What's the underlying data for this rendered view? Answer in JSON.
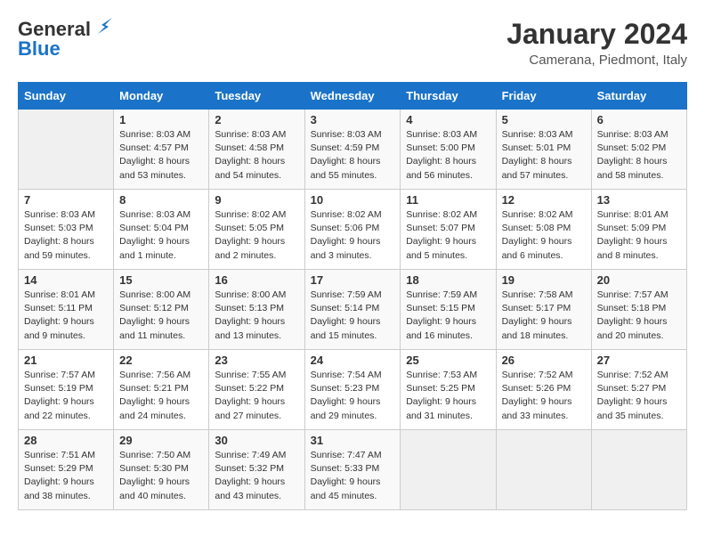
{
  "logo": {
    "line1": "General",
    "line2": "Blue"
  },
  "title": "January 2024",
  "location": "Camerana, Piedmont, Italy",
  "weekdays": [
    "Sunday",
    "Monday",
    "Tuesday",
    "Wednesday",
    "Thursday",
    "Friday",
    "Saturday"
  ],
  "weeks": [
    [
      {
        "day": "",
        "info": ""
      },
      {
        "day": "1",
        "info": "Sunrise: 8:03 AM\nSunset: 4:57 PM\nDaylight: 8 hours\nand 53 minutes."
      },
      {
        "day": "2",
        "info": "Sunrise: 8:03 AM\nSunset: 4:58 PM\nDaylight: 8 hours\nand 54 minutes."
      },
      {
        "day": "3",
        "info": "Sunrise: 8:03 AM\nSunset: 4:59 PM\nDaylight: 8 hours\nand 55 minutes."
      },
      {
        "day": "4",
        "info": "Sunrise: 8:03 AM\nSunset: 5:00 PM\nDaylight: 8 hours\nand 56 minutes."
      },
      {
        "day": "5",
        "info": "Sunrise: 8:03 AM\nSunset: 5:01 PM\nDaylight: 8 hours\nand 57 minutes."
      },
      {
        "day": "6",
        "info": "Sunrise: 8:03 AM\nSunset: 5:02 PM\nDaylight: 8 hours\nand 58 minutes."
      }
    ],
    [
      {
        "day": "7",
        "info": "Sunrise: 8:03 AM\nSunset: 5:03 PM\nDaylight: 8 hours\nand 59 minutes."
      },
      {
        "day": "8",
        "info": "Sunrise: 8:03 AM\nSunset: 5:04 PM\nDaylight: 9 hours\nand 1 minute."
      },
      {
        "day": "9",
        "info": "Sunrise: 8:02 AM\nSunset: 5:05 PM\nDaylight: 9 hours\nand 2 minutes."
      },
      {
        "day": "10",
        "info": "Sunrise: 8:02 AM\nSunset: 5:06 PM\nDaylight: 9 hours\nand 3 minutes."
      },
      {
        "day": "11",
        "info": "Sunrise: 8:02 AM\nSunset: 5:07 PM\nDaylight: 9 hours\nand 5 minutes."
      },
      {
        "day": "12",
        "info": "Sunrise: 8:02 AM\nSunset: 5:08 PM\nDaylight: 9 hours\nand 6 minutes."
      },
      {
        "day": "13",
        "info": "Sunrise: 8:01 AM\nSunset: 5:09 PM\nDaylight: 9 hours\nand 8 minutes."
      }
    ],
    [
      {
        "day": "14",
        "info": "Sunrise: 8:01 AM\nSunset: 5:11 PM\nDaylight: 9 hours\nand 9 minutes."
      },
      {
        "day": "15",
        "info": "Sunrise: 8:00 AM\nSunset: 5:12 PM\nDaylight: 9 hours\nand 11 minutes."
      },
      {
        "day": "16",
        "info": "Sunrise: 8:00 AM\nSunset: 5:13 PM\nDaylight: 9 hours\nand 13 minutes."
      },
      {
        "day": "17",
        "info": "Sunrise: 7:59 AM\nSunset: 5:14 PM\nDaylight: 9 hours\nand 15 minutes."
      },
      {
        "day": "18",
        "info": "Sunrise: 7:59 AM\nSunset: 5:15 PM\nDaylight: 9 hours\nand 16 minutes."
      },
      {
        "day": "19",
        "info": "Sunrise: 7:58 AM\nSunset: 5:17 PM\nDaylight: 9 hours\nand 18 minutes."
      },
      {
        "day": "20",
        "info": "Sunrise: 7:57 AM\nSunset: 5:18 PM\nDaylight: 9 hours\nand 20 minutes."
      }
    ],
    [
      {
        "day": "21",
        "info": "Sunrise: 7:57 AM\nSunset: 5:19 PM\nDaylight: 9 hours\nand 22 minutes."
      },
      {
        "day": "22",
        "info": "Sunrise: 7:56 AM\nSunset: 5:21 PM\nDaylight: 9 hours\nand 24 minutes."
      },
      {
        "day": "23",
        "info": "Sunrise: 7:55 AM\nSunset: 5:22 PM\nDaylight: 9 hours\nand 27 minutes."
      },
      {
        "day": "24",
        "info": "Sunrise: 7:54 AM\nSunset: 5:23 PM\nDaylight: 9 hours\nand 29 minutes."
      },
      {
        "day": "25",
        "info": "Sunrise: 7:53 AM\nSunset: 5:25 PM\nDaylight: 9 hours\nand 31 minutes."
      },
      {
        "day": "26",
        "info": "Sunrise: 7:52 AM\nSunset: 5:26 PM\nDaylight: 9 hours\nand 33 minutes."
      },
      {
        "day": "27",
        "info": "Sunrise: 7:52 AM\nSunset: 5:27 PM\nDaylight: 9 hours\nand 35 minutes."
      }
    ],
    [
      {
        "day": "28",
        "info": "Sunrise: 7:51 AM\nSunset: 5:29 PM\nDaylight: 9 hours\nand 38 minutes."
      },
      {
        "day": "29",
        "info": "Sunrise: 7:50 AM\nSunset: 5:30 PM\nDaylight: 9 hours\nand 40 minutes."
      },
      {
        "day": "30",
        "info": "Sunrise: 7:49 AM\nSunset: 5:32 PM\nDaylight: 9 hours\nand 43 minutes."
      },
      {
        "day": "31",
        "info": "Sunrise: 7:47 AM\nSunset: 5:33 PM\nDaylight: 9 hours\nand 45 minutes."
      },
      {
        "day": "",
        "info": ""
      },
      {
        "day": "",
        "info": ""
      },
      {
        "day": "",
        "info": ""
      }
    ]
  ]
}
